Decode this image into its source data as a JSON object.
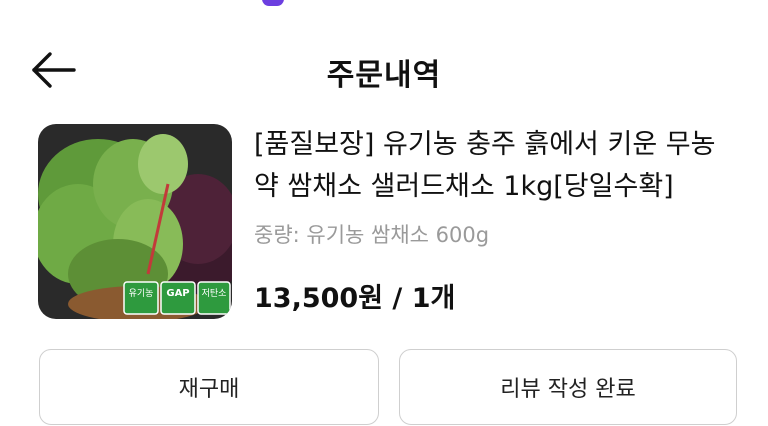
{
  "header": {
    "title": "주문내역"
  },
  "order_item": {
    "product_name": "[품질보장] 유기농 충주 흙에서 키운 무농약 쌈채소 샐러드채소 1kg[당일수확]",
    "option_label": "중량: 유기농 쌈채소 600g",
    "price": "13,500원",
    "separator": " / ",
    "quantity": "1개",
    "image_badges": [
      "유기농",
      "GAP",
      "저탄소"
    ]
  },
  "actions": {
    "rebuy_label": "재구매",
    "review_label": "리뷰 작성 완료"
  },
  "colors": {
    "badge_green": "#2e9a3e",
    "muted_text": "#9a9a9a",
    "button_border": "#cfcfcf"
  }
}
